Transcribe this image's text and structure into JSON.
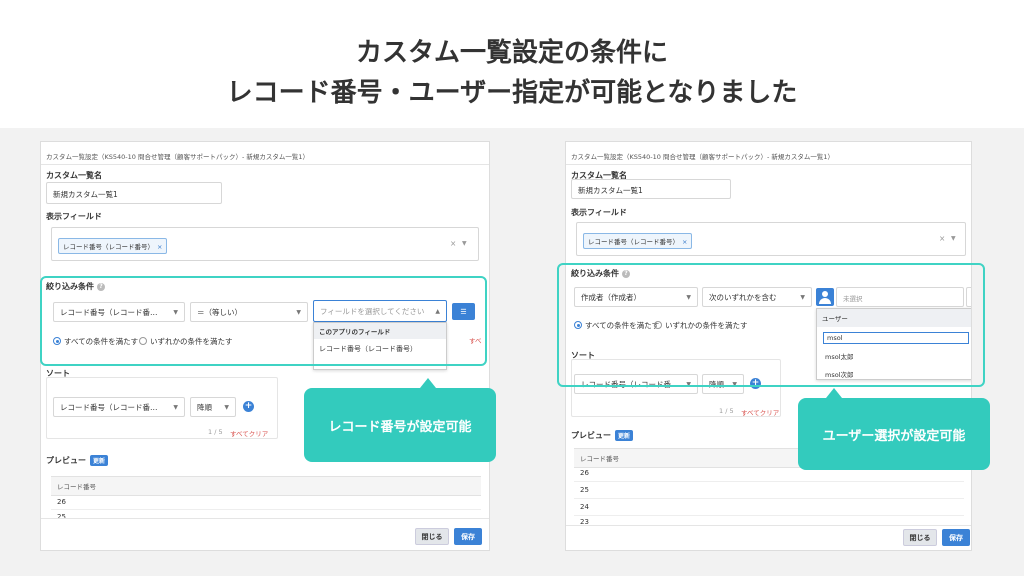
{
  "headline": {
    "line1": "カスタム一覧設定の条件に",
    "line2": "レコード番号・ユーザー指定が可能となりました"
  },
  "left": {
    "breadcrumb": "カスタム一覧設定（KS540-10 問合せ管理（顧客サポートパック）- 新規カスタム一覧1）",
    "list_name_label": "カスタム一覧名",
    "list_name_value": "新規カスタム一覧1",
    "display_fields_label": "表示フィールド",
    "display_field_tag": "レコード番号（レコード番号）",
    "filter_label": "絞り込み条件",
    "filter_field": "レコード番号（レコード番…",
    "filter_operator": "＝（等しい）",
    "filter_value_placeholder": "フィールドを選択してください",
    "dropdown_header": "このアプリのフィールド",
    "dropdown_item": "レコード番号（レコード番号）",
    "radio_all": "すべての条件を満たす",
    "radio_any": "いずれかの条件を満たす",
    "cut_link": "すべ",
    "sort_label": "ソート",
    "sort_field": "レコード番号（レコード番…",
    "sort_order": "降順",
    "pager": "1 / 5",
    "clear_all": "すべてクリア",
    "preview_label": "プレビュー",
    "refresh_badge": "更新",
    "table_header": "レコード番号",
    "rows": [
      "26",
      "25"
    ],
    "close_label": "閉じる",
    "save_label": "保存",
    "callout": "レコード番号が設定可能"
  },
  "right": {
    "breadcrumb": "カスタム一覧設定（KS540-10 問合せ管理（顧客サポートパック）- 新規カスタム一覧1）",
    "list_name_label": "カスタム一覧名",
    "list_name_value": "新規カスタム一覧1",
    "display_fields_label": "表示フィールド",
    "display_field_tag": "レコード番号（レコード番号）",
    "filter_label": "絞り込み条件",
    "filter_field": "作成者（作成者）",
    "filter_operator": "次のいずれかを含む",
    "user_input_placeholder": "未選択",
    "dropdown_header": "ユーザー",
    "dropdown_search": "msol",
    "dropdown_items": [
      "msol太郎",
      "msol次郎"
    ],
    "radio_all": "すべての条件を満たす",
    "radio_any": "いずれかの条件を満たす",
    "sort_label": "ソート",
    "sort_field": "レコード番号（レコード番…",
    "sort_order": "降順",
    "pager": "1 / 5",
    "clear_all": "すべてクリア",
    "preview_label": "プレビュー",
    "refresh_badge": "更新",
    "table_header": "レコード番号",
    "rows": [
      "26",
      "25",
      "24",
      "23"
    ],
    "close_label": "閉じる",
    "save_label": "保存",
    "callout": "ユーザー選択が設定可能"
  },
  "colors": {
    "accent": "#3b82d6",
    "highlight": "#3fd3c4",
    "callout": "#33cbbd"
  }
}
